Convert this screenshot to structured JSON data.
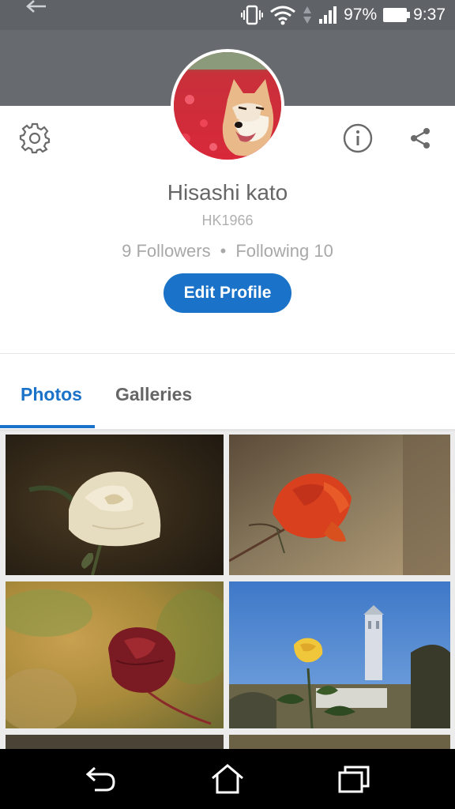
{
  "status_bar": {
    "battery": "97%",
    "time": "9:37"
  },
  "profile": {
    "name": "Hisashi kato",
    "handle": "HK1966",
    "followers": "9 Followers",
    "separator": "•",
    "following": "Following 10",
    "edit_button": "Edit Profile"
  },
  "tabs": [
    {
      "label": "Photos",
      "active": true
    },
    {
      "label": "Galleries",
      "active": false
    }
  ],
  "photos": [
    {
      "subject": "white rose"
    },
    {
      "subject": "red-orange rose"
    },
    {
      "subject": "dark red rose"
    },
    {
      "subject": "yellow rose with tower"
    }
  ],
  "colors": {
    "accent": "#1a73c8",
    "header": "#676b6f",
    "status_bar": "#5f6368"
  },
  "icons": {
    "settings": "gear-icon",
    "info": "info-icon",
    "share": "share-icon",
    "back": "arrow-back-icon",
    "nav_back": "nav-back-icon",
    "nav_home": "nav-home-icon",
    "nav_recent": "nav-recent-icon"
  }
}
